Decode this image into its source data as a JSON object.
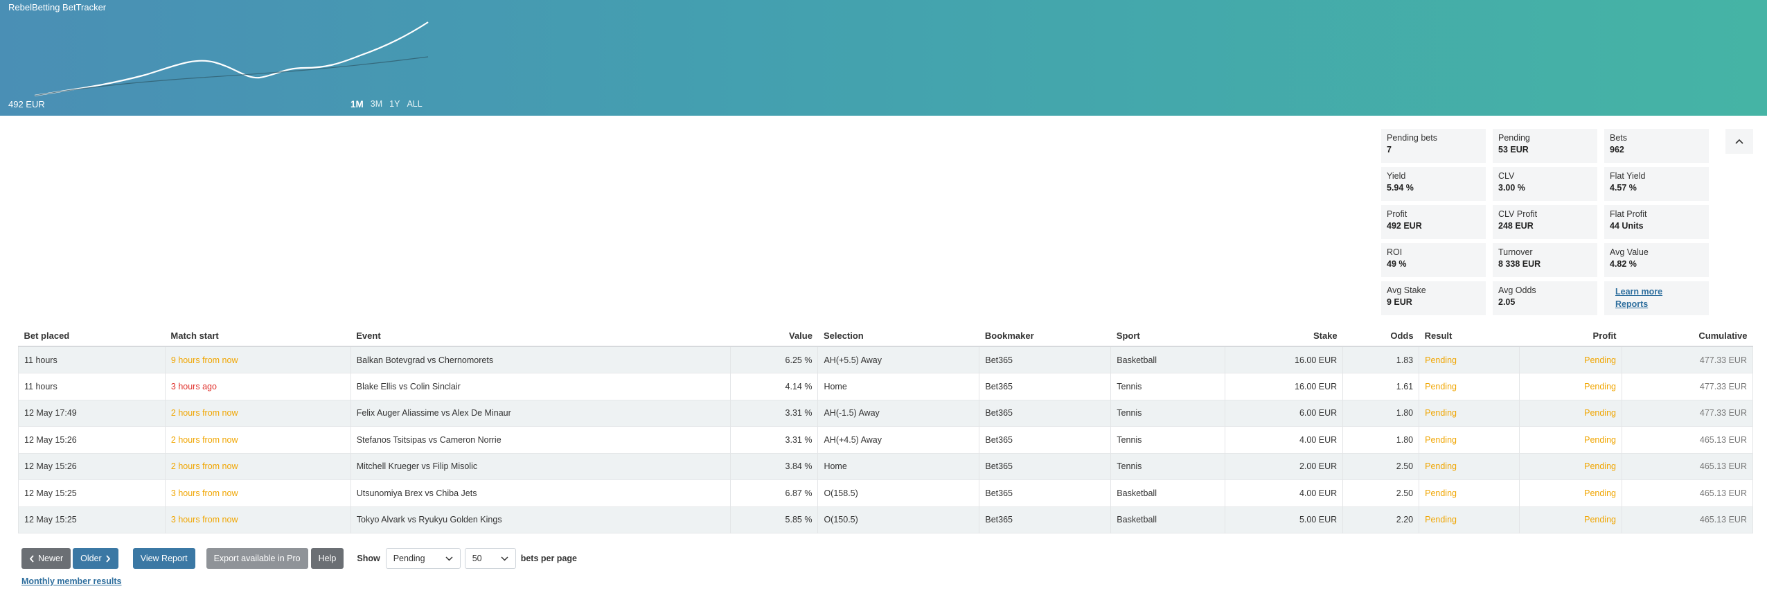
{
  "header": {
    "app_title": "RebelBetting BetTracker",
    "balance_label": "492 EUR",
    "ranges": [
      {
        "label": "1M",
        "active": true
      },
      {
        "label": "3M",
        "active": false
      },
      {
        "label": "1Y",
        "active": false
      },
      {
        "label": "ALL",
        "active": false
      }
    ]
  },
  "stats": [
    {
      "label": "Pending bets",
      "value": "7"
    },
    {
      "label": "Pending",
      "value": "53 EUR"
    },
    {
      "label": "Bets",
      "value": "962"
    },
    {
      "label": "Yield",
      "value": "5.94 %"
    },
    {
      "label": "CLV",
      "value": "3.00 %"
    },
    {
      "label": "Flat Yield",
      "value": "4.57 %"
    },
    {
      "label": "Profit",
      "value": "492 EUR"
    },
    {
      "label": "CLV Profit",
      "value": "248 EUR"
    },
    {
      "label": "Flat Profit",
      "value": "44 Units"
    },
    {
      "label": "ROI",
      "value": "49 %"
    },
    {
      "label": "Turnover",
      "value": "8 338 EUR"
    },
    {
      "label": "Avg Value",
      "value": "4.82 %"
    },
    {
      "label": "Avg Stake",
      "value": "9 EUR"
    },
    {
      "label": "Avg Odds",
      "value": "2.05"
    }
  ],
  "links": {
    "learn_more": "Learn more",
    "reports": "Reports"
  },
  "table": {
    "columns": [
      "Bet placed",
      "Match start",
      "Event",
      "Value",
      "Selection",
      "Bookmaker",
      "Sport",
      "Stake",
      "Odds",
      "Result",
      "Profit",
      "Cumulative"
    ],
    "rows": [
      {
        "placed": "11 hours",
        "start": "9 hours from now",
        "start_status": "future",
        "event": "Balkan Botevgrad vs Chernomorets",
        "value": "6.25 %",
        "selection": "AH(+5.5) Away",
        "bookmaker": "Bet365",
        "sport": "Basketball",
        "stake": "16.00 EUR",
        "odds": "1.83",
        "result": "Pending",
        "profit": "Pending",
        "cumulative": "477.33 EUR"
      },
      {
        "placed": "11 hours",
        "start": "3 hours ago",
        "start_status": "past",
        "event": "Blake Ellis vs Colin Sinclair",
        "value": "4.14 %",
        "selection": "Home",
        "bookmaker": "Bet365",
        "sport": "Tennis",
        "stake": "16.00 EUR",
        "odds": "1.61",
        "result": "Pending",
        "profit": "Pending",
        "cumulative": "477.33 EUR"
      },
      {
        "placed": "12 May 17:49",
        "start": "2 hours from now",
        "start_status": "future",
        "event": "Felix Auger Aliassime vs Alex De Minaur",
        "value": "3.31 %",
        "selection": "AH(-1.5) Away",
        "bookmaker": "Bet365",
        "sport": "Tennis",
        "stake": "6.00 EUR",
        "odds": "1.80",
        "result": "Pending",
        "profit": "Pending",
        "cumulative": "477.33 EUR"
      },
      {
        "placed": "12 May 15:26",
        "start": "2 hours from now",
        "start_status": "future",
        "event": "Stefanos Tsitsipas vs Cameron Norrie",
        "value": "3.31 %",
        "selection": "AH(+4.5) Away",
        "bookmaker": "Bet365",
        "sport": "Tennis",
        "stake": "4.00 EUR",
        "odds": "1.80",
        "result": "Pending",
        "profit": "Pending",
        "cumulative": "465.13 EUR"
      },
      {
        "placed": "12 May 15:26",
        "start": "2 hours from now",
        "start_status": "future",
        "event": "Mitchell Krueger vs Filip Misolic",
        "value": "3.84 %",
        "selection": "Home",
        "bookmaker": "Bet365",
        "sport": "Tennis",
        "stake": "2.00 EUR",
        "odds": "2.50",
        "result": "Pending",
        "profit": "Pending",
        "cumulative": "465.13 EUR"
      },
      {
        "placed": "12 May 15:25",
        "start": "3 hours from now",
        "start_status": "future",
        "event": "Utsunomiya Brex vs Chiba Jets",
        "value": "6.87 %",
        "selection": "O(158.5)",
        "bookmaker": "Bet365",
        "sport": "Basketball",
        "stake": "4.00 EUR",
        "odds": "2.50",
        "result": "Pending",
        "profit": "Pending",
        "cumulative": "465.13 EUR"
      },
      {
        "placed": "12 May 15:25",
        "start": "3 hours from now",
        "start_status": "future",
        "event": "Tokyo Alvark vs Ryukyu Golden Kings",
        "value": "5.85 %",
        "selection": "O(150.5)",
        "bookmaker": "Bet365",
        "sport": "Basketball",
        "stake": "5.00 EUR",
        "odds": "2.20",
        "result": "Pending",
        "profit": "Pending",
        "cumulative": "465.13 EUR"
      }
    ]
  },
  "footer": {
    "newer": "Newer",
    "older": "Older",
    "view_report": "View Report",
    "export": "Export available in Pro",
    "help": "Help",
    "show": "Show",
    "filter_value": "Pending",
    "per_page_value": "50",
    "per_page_suffix": "bets per page",
    "monthly": "Monthly member results"
  },
  "colors": {
    "future": "#f0a500",
    "past": "#e0322d",
    "pending": "#f0a500",
    "button": "#3b78a4"
  },
  "icons": {
    "collapse": "chevron-up-icon",
    "newer": "chevron-left-icon",
    "older": "chevron-right-icon",
    "select": "chevron-down-icon"
  }
}
